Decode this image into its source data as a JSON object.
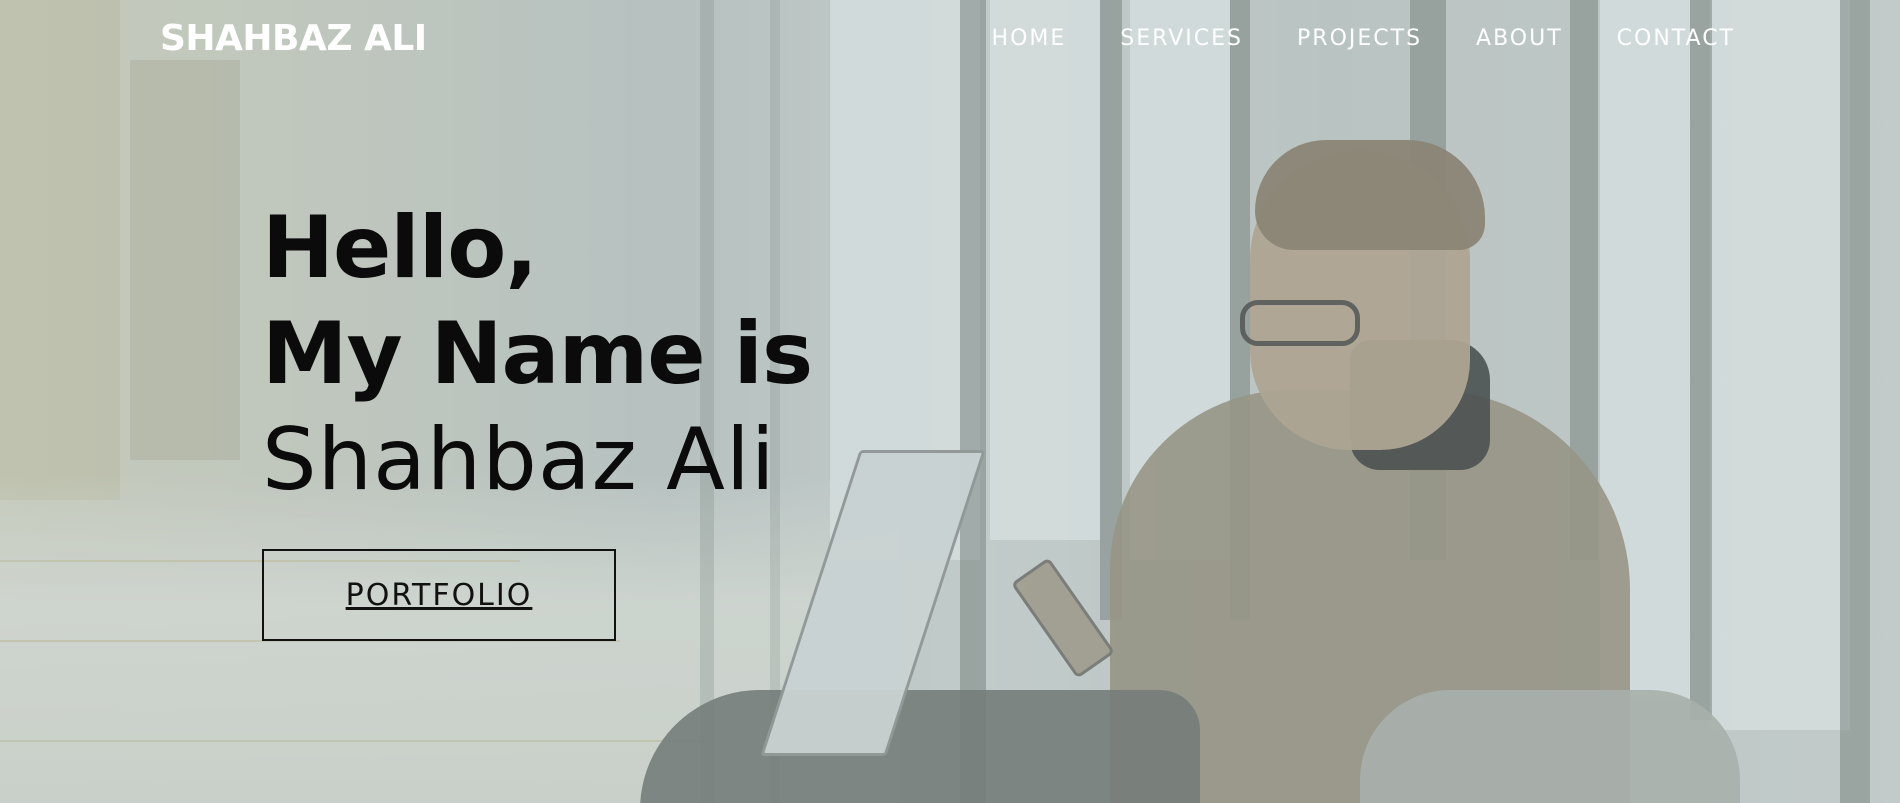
{
  "navbar": {
    "brand": "SHAHBAZ ALI",
    "links": [
      "HOME",
      "SERVICES",
      "PROJECTS",
      "ABOUT",
      "CONTACT"
    ]
  },
  "hero": {
    "greeting": "Hello,",
    "intro": "My Name is",
    "name": "Shahbaz Ali",
    "cta_label": "PORTFOLIO",
    "background_image": "man-with-laptop-and-phone-by-window"
  },
  "colors": {
    "nav_text": "#ffffff",
    "heading_text": "#0b0b0b",
    "overlay_tint": "#bfcdcd"
  }
}
